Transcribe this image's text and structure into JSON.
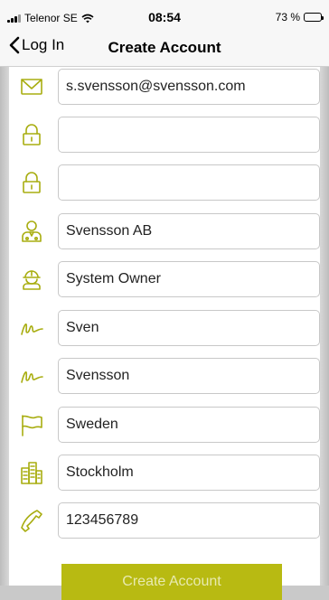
{
  "status_bar": {
    "carrier": "Telenor SE",
    "time": "08:54",
    "battery": "73 %"
  },
  "nav": {
    "back_label": "Log In",
    "title": "Create Account"
  },
  "form": {
    "email": "s.svensson@svensson.com",
    "password": "",
    "confirm_password": "",
    "company": "Svensson AB",
    "role": "System Owner",
    "first_name": "Sven",
    "last_name": "Svensson",
    "country": "Sweden",
    "city": "Stockholm",
    "phone": "123456789"
  },
  "submit_label": "Create Account",
  "colors": {
    "accent": "#b8ba12",
    "icon": "#a8ad10",
    "background": "#ffffff"
  },
  "icons": [
    "mail-icon",
    "lock-icon",
    "lock-icon",
    "company-person-icon",
    "worker-helmet-icon",
    "signature-icon",
    "signature-icon",
    "flag-icon",
    "city-buildings-icon",
    "phone-icon"
  ]
}
